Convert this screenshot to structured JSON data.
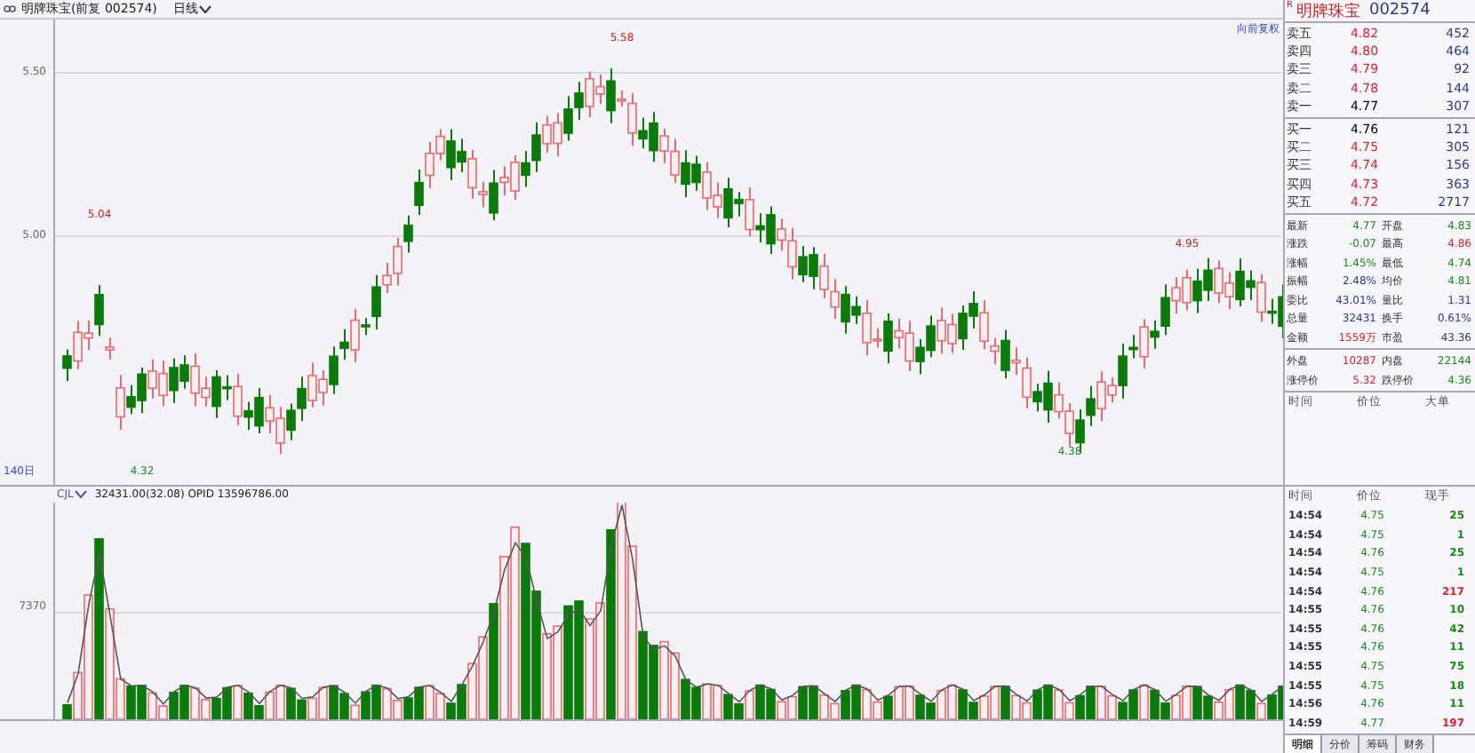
{
  "header": {
    "stock": "明牌珠宝(前复 002574)",
    "period": "日线",
    "mode": "向前复权"
  },
  "price_axis": [
    "5.50",
    "5.00"
  ],
  "price_marks": [
    {
      "text": "5.58",
      "kind": "high"
    },
    {
      "text": "5.04",
      "kind": "high"
    },
    {
      "text": "4.32",
      "kind": "low"
    },
    {
      "text": "4.38",
      "kind": "low"
    },
    {
      "text": "4.95",
      "kind": "high"
    }
  ],
  "range_label": "140日",
  "volume": {
    "indicator": "CJL",
    "readout": "32431.00(32.08)  OPID 13596786.00",
    "axis": "7370"
  },
  "quote": {
    "badge": "R",
    "name": "明牌珠宝",
    "code": "002574",
    "asks": [
      {
        "label": "卖五",
        "price": "4.82",
        "volume": "452",
        "color": "#e0202a"
      },
      {
        "label": "卖四",
        "price": "4.80",
        "volume": "464",
        "color": "#e0202a"
      },
      {
        "label": "卖三",
        "price": "4.79",
        "volume": "92",
        "color": "#e0202a"
      },
      {
        "label": "卖二",
        "price": "4.78",
        "volume": "144",
        "color": "#e0202a"
      },
      {
        "label": "卖一",
        "price": "4.77",
        "volume": "307",
        "color": "#000000"
      }
    ],
    "bids": [
      {
        "label": "买一",
        "price": "4.76",
        "volume": "121",
        "color": "#000000"
      },
      {
        "label": "买二",
        "price": "4.75",
        "volume": "305",
        "color": "#e0202a"
      },
      {
        "label": "买三",
        "price": "4.74",
        "volume": "156",
        "color": "#e0202a"
      },
      {
        "label": "买四",
        "price": "4.73",
        "volume": "363",
        "color": "#e0202a"
      },
      {
        "label": "买五",
        "price": "4.72",
        "volume": "2717",
        "color": "#e0202a"
      }
    ],
    "stats": [
      {
        "label": "最新",
        "value": "4.77",
        "color": "#1a8a1a"
      },
      {
        "label": "开盘",
        "value": "4.83",
        "color": "#1a8a1a"
      },
      {
        "label": "涨跌",
        "value": "-0.07",
        "color": "#1a8a1a"
      },
      {
        "label": "最高",
        "value": "4.86",
        "color": "#e0202a"
      },
      {
        "label": "涨幅",
        "value": "1.45%",
        "color": "#1a8a1a"
      },
      {
        "label": "最低",
        "value": "4.74",
        "color": "#1a8a1a"
      },
      {
        "label": "振幅",
        "value": "2.48%",
        "color": "#2a3a8a"
      },
      {
        "label": "均价",
        "value": "4.81",
        "color": "#1a8a1a"
      },
      {
        "label": "委比",
        "value": "43.01%",
        "color": "#2a3a8a"
      },
      {
        "label": "量比",
        "value": "1.31",
        "color": "#2a3a8a"
      },
      {
        "label": "总量",
        "value": "32431",
        "color": "#2a3a8a"
      },
      {
        "label": "换手",
        "value": "0.61%",
        "color": "#2a3a8a"
      },
      {
        "label": "金额",
        "value": "1559万",
        "color": "#e0202a"
      },
      {
        "label": "市盈",
        "value": "43.36",
        "color": "#2a3a8a"
      }
    ],
    "flows": [
      {
        "label": "外盘",
        "value": "10287",
        "color": "#e0202a"
      },
      {
        "label": "内盘",
        "value": "22144",
        "color": "#1a8a1a"
      },
      {
        "label": "涨停价",
        "value": "5.32",
        "color": "#e0202a"
      },
      {
        "label": "跌停价",
        "value": "4.36",
        "color": "#1a8a1a"
      }
    ],
    "big_orders": {
      "columns": [
        "时间",
        "价位",
        "大单"
      ]
    },
    "ticks": {
      "columns": [
        "时间",
        "价位",
        "现手"
      ],
      "rows": [
        {
          "time": "14:54",
          "price": "4.75",
          "qty": "25",
          "color": "#1a8a1a"
        },
        {
          "time": "14:54",
          "price": "4.75",
          "qty": "1",
          "color": "#1a8a1a"
        },
        {
          "time": "14:54",
          "price": "4.76",
          "qty": "25",
          "color": "#1a8a1a"
        },
        {
          "time": "14:54",
          "price": "4.75",
          "qty": "1",
          "color": "#1a8a1a"
        },
        {
          "time": "14:54",
          "price": "4.76",
          "qty": "217",
          "color": "#e0202a"
        },
        {
          "time": "14:55",
          "price": "4.76",
          "qty": "10",
          "color": "#1a8a1a"
        },
        {
          "time": "14:55",
          "price": "4.76",
          "qty": "42",
          "color": "#1a8a1a"
        },
        {
          "time": "14:55",
          "price": "4.76",
          "qty": "11",
          "color": "#1a8a1a"
        },
        {
          "time": "14:55",
          "price": "4.75",
          "qty": "75",
          "color": "#1a8a1a"
        },
        {
          "time": "14:55",
          "price": "4.75",
          "qty": "18",
          "color": "#1a8a1a"
        },
        {
          "time": "14:56",
          "price": "4.76",
          "qty": "11",
          "color": "#1a8a1a"
        },
        {
          "time": "14:59",
          "price": "4.77",
          "qty": "197",
          "color": "#e0202a"
        }
      ]
    }
  },
  "tabs": [
    {
      "label": "明细",
      "selected": true
    },
    {
      "label": "分价",
      "selected": false
    },
    {
      "label": "筹码",
      "selected": false
    },
    {
      "label": "财务",
      "selected": false
    }
  ]
}
